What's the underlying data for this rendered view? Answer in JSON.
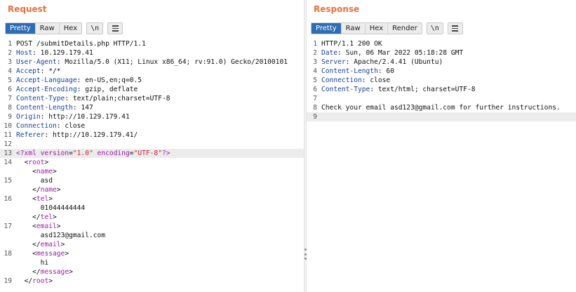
{
  "request": {
    "title": "Request",
    "tabs": [
      {
        "label": "Pretty",
        "active": true
      },
      {
        "label": "Raw",
        "active": false
      },
      {
        "label": "Hex",
        "active": false
      }
    ],
    "newline_label": "\\n",
    "headers": [
      {
        "ln": "1",
        "plain": "POST /submitDetails.php HTTP/1.1"
      },
      {
        "ln": "2",
        "key": "Host",
        "value": " 10.129.179.41"
      },
      {
        "ln": "3",
        "key": "User-Agent",
        "value": " Mozilla/5.0 (X11; Linux x86_64; rv:91.0) Gecko/20100101"
      },
      {
        "ln": "4",
        "key": "Accept",
        "value": " */*"
      },
      {
        "ln": "5",
        "key": "Accept-Language",
        "value": " en-US,en;q=0.5"
      },
      {
        "ln": "6",
        "key": "Accept-Encoding",
        "value": " gzip, deflate"
      },
      {
        "ln": "7",
        "key": "Content-Type",
        "value": " text/plain;charset=UTF-8"
      },
      {
        "ln": "8",
        "key": "Content-Length",
        "value": " 147"
      },
      {
        "ln": "9",
        "key": "Origin",
        "value": " http://10.129.179.41"
      },
      {
        "ln": "10",
        "key": "Connection",
        "value": " close"
      },
      {
        "ln": "11",
        "key": "Referer",
        "value": " http://10.129.179.41/"
      },
      {
        "ln": "12",
        "plain": ""
      }
    ],
    "xml_decl": {
      "ln": "13",
      "open": "<?xml ",
      "attr1": "version",
      "eq1": "=",
      "val1": "\"1.0\"",
      "sp": " ",
      "attr2": "encoding",
      "eq2": "=",
      "val2": "\"UTF-8\"",
      "close": "?>"
    },
    "xml_lines": [
      {
        "ln": "14",
        "indent": "  ",
        "tag": "root",
        "kind": "open"
      },
      {
        "ln": "",
        "indent": "    ",
        "tag": "name",
        "kind": "open"
      },
      {
        "ln": "",
        "indent": "      ",
        "text": "asd",
        "kind": "text"
      },
      {
        "ln": "",
        "indent": "    ",
        "tag": "name",
        "kind": "close"
      },
      {
        "ln": "16",
        "indent": "    ",
        "tag": "tel",
        "kind": "open"
      },
      {
        "ln": "",
        "indent": "      ",
        "text": "01044444444",
        "kind": "text"
      },
      {
        "ln": "",
        "indent": "    ",
        "tag": "tel",
        "kind": "close"
      },
      {
        "ln": "17",
        "indent": "    ",
        "tag": "email",
        "kind": "open"
      },
      {
        "ln": "",
        "indent": "      ",
        "text": "asd123@gmail.com",
        "kind": "text"
      },
      {
        "ln": "",
        "indent": "    ",
        "tag": "email",
        "kind": "close"
      },
      {
        "ln": "18",
        "indent": "    ",
        "tag": "message",
        "kind": "open"
      },
      {
        "ln": "",
        "indent": "      ",
        "text": "hi",
        "kind": "text"
      },
      {
        "ln": "",
        "indent": "    ",
        "tag": "message",
        "kind": "close"
      },
      {
        "ln": "19",
        "indent": "  ",
        "tag": "root",
        "kind": "close"
      }
    ],
    "line15": "15"
  },
  "response": {
    "title": "Response",
    "tabs": [
      {
        "label": "Pretty",
        "active": true
      },
      {
        "label": "Raw",
        "active": false
      },
      {
        "label": "Hex",
        "active": false
      },
      {
        "label": "Render",
        "active": false
      }
    ],
    "newline_label": "\\n",
    "lines": [
      {
        "ln": "1",
        "plain": "HTTP/1.1 200 OK"
      },
      {
        "ln": "2",
        "key": "Date",
        "value": " Sun, 06 Mar 2022 05:18:28 GMT"
      },
      {
        "ln": "3",
        "key": "Server",
        "value": " Apache/2.4.41 (Ubuntu)"
      },
      {
        "ln": "4",
        "key": "Content-Length",
        "value": " 60"
      },
      {
        "ln": "5",
        "key": "Connection",
        "value": " close"
      },
      {
        "ln": "6",
        "key": "Content-Type",
        "value": " text/html; charset=UTF-8"
      },
      {
        "ln": "7",
        "plain": ""
      },
      {
        "ln": "8",
        "plain": "Check your email asd123@gmail.com for further instructions."
      },
      {
        "ln": "9",
        "plain": "",
        "highlight": true
      }
    ]
  },
  "colors": {
    "title": "#e8703a",
    "active_tab": "#2d6db5",
    "header_key": "#1a3f99",
    "xml_tag": "#9b1aa8",
    "xml_value": "#c6233a"
  }
}
